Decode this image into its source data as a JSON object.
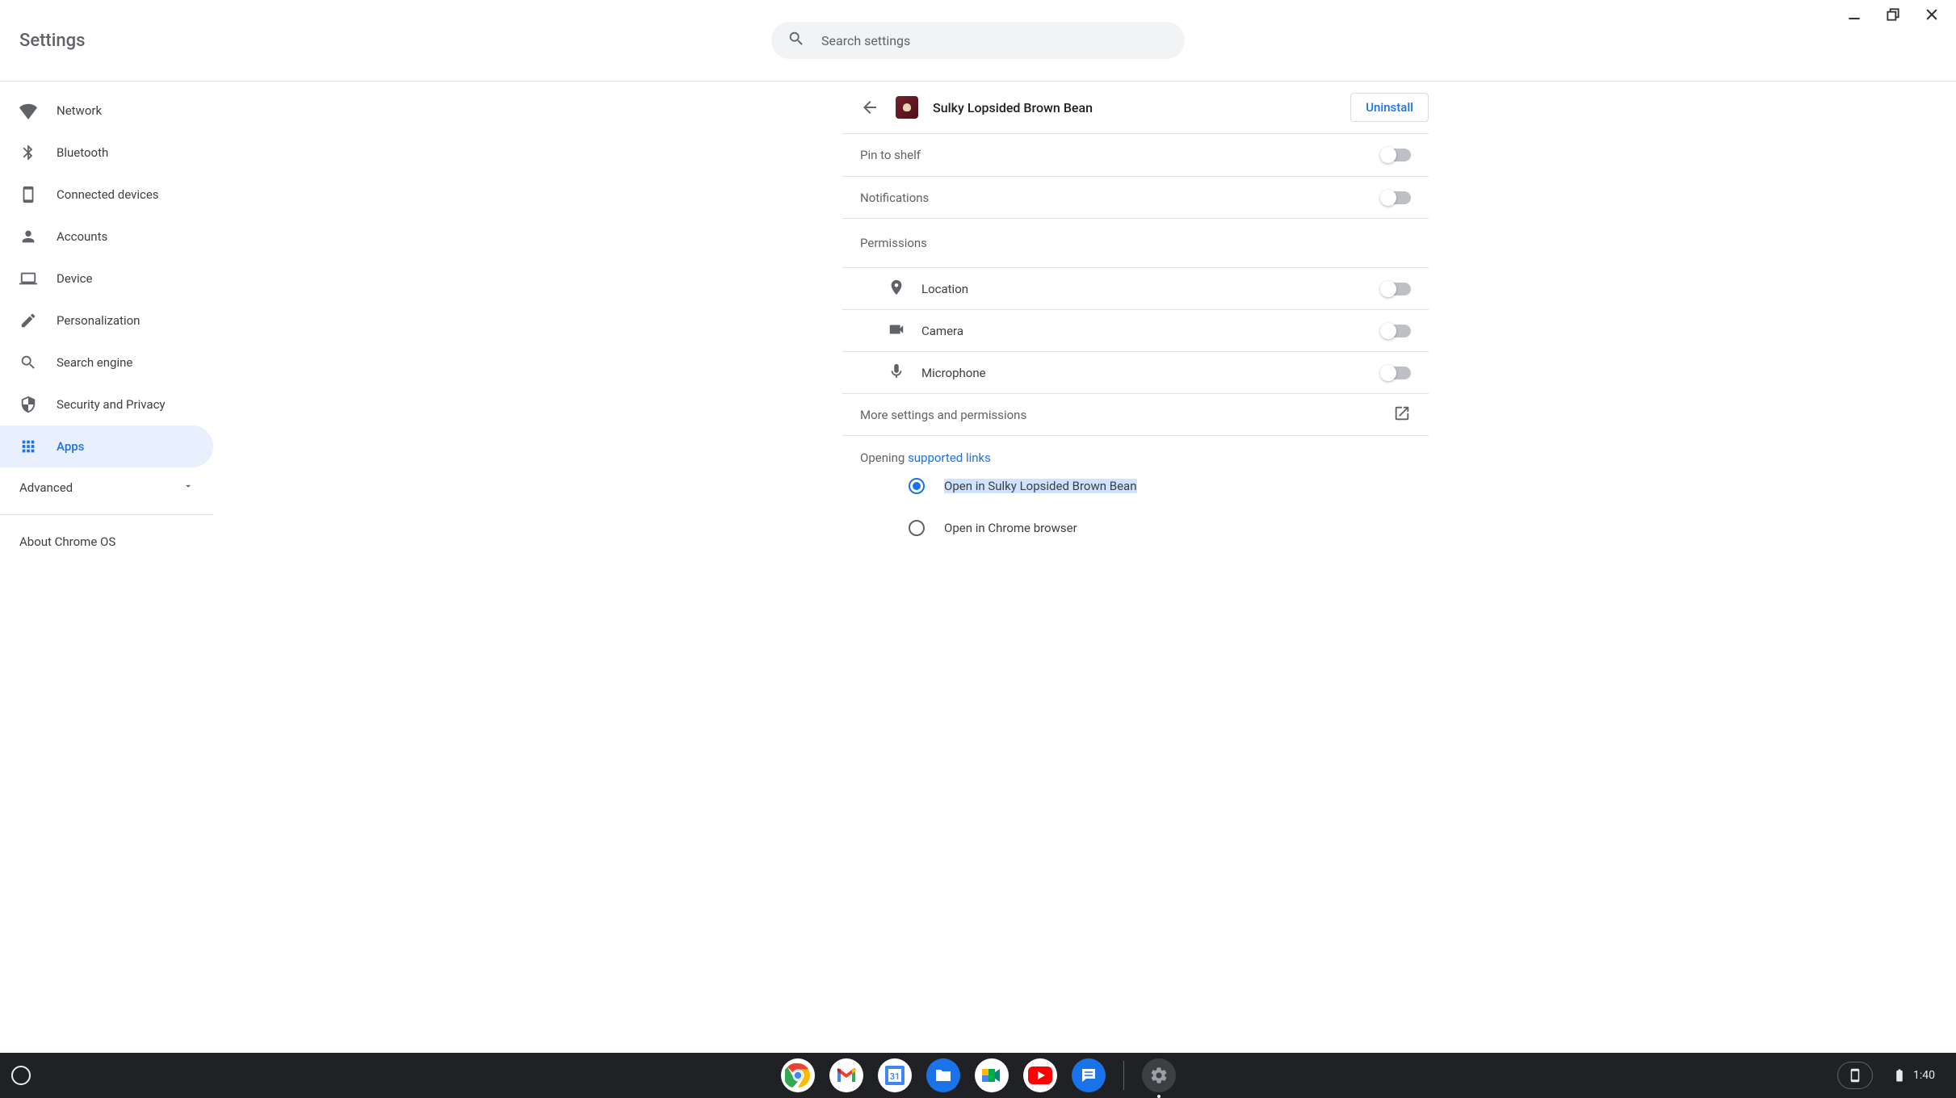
{
  "header": {
    "title": "Settings"
  },
  "search": {
    "placeholder": "Search settings"
  },
  "sidebar": {
    "items": [
      {
        "label": "Network"
      },
      {
        "label": "Bluetooth"
      },
      {
        "label": "Connected devices"
      },
      {
        "label": "Accounts"
      },
      {
        "label": "Device"
      },
      {
        "label": "Personalization"
      },
      {
        "label": "Search engine"
      },
      {
        "label": "Security and Privacy"
      },
      {
        "label": "Apps"
      }
    ],
    "advanced": "Advanced",
    "about": "About Chrome OS"
  },
  "app": {
    "title": "Sulky Lopsided Brown Bean",
    "uninstall": "Uninstall",
    "pin_to_shelf": "Pin to shelf",
    "notifications": "Notifications",
    "permissions_header": "Permissions",
    "permissions": {
      "location": "Location",
      "camera": "Camera",
      "microphone": "Microphone"
    },
    "more_settings": "More settings and permissions",
    "opening_prefix": "Opening ",
    "opening_link": "supported links",
    "radio_open_app": "Open in Sulky Lopsided Brown Bean",
    "radio_open_browser": "Open in Chrome browser"
  },
  "shelf": {
    "time": "1:40"
  }
}
